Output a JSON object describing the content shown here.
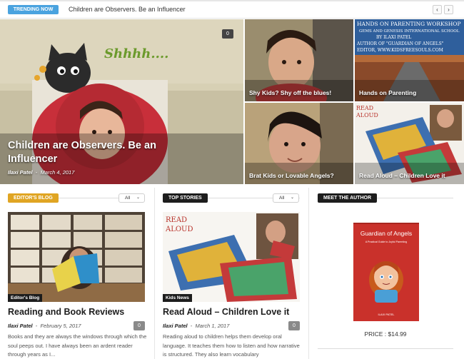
{
  "trending": {
    "badge": "TRENDING NOW",
    "headline": "Children are Observers. Be an Influencer",
    "prev_icon": "chevron-left-icon",
    "next_icon": "chevron-right-icon"
  },
  "featured": {
    "main": {
      "title": "Children are Observers. Be an Influencer",
      "author": "Ilaxi Patel",
      "date": "March 4, 2017",
      "comments": "0",
      "image_text": "Shhhh...."
    },
    "tiles": [
      {
        "title": "Shy Kids? Shy off the blues!"
      },
      {
        "title": "Hands on Parenting",
        "image_lines": [
          "HANDS ON PARENTING WORKSHOP",
          "GEMS AND GENESIS INTERNATIONAL SCHOOL",
          "BY ILAXI PATEL",
          "AUTHOR OF \"GUARDIAN OF ANGELS\"",
          "EDITOR, WWW.KIDSFREESOULS.COM"
        ]
      },
      {
        "title": "Brat Kids or Lovable Angels?"
      },
      {
        "title": "Read Aloud – Children Love it",
        "image_lines": [
          "READ",
          "ALOUD"
        ]
      }
    ]
  },
  "editors_blog": {
    "header": "EDITOR'S BLOG",
    "filter": "All",
    "category": "Editor's Blog",
    "title": "Reading and Book Reviews",
    "author": "Ilaxi Patel",
    "date": "February 5, 2017",
    "comments": "0",
    "excerpt": "Books and they are always the windows through which the soul peeps out. I have always been an ardent reader through years as I..."
  },
  "top_stories": {
    "header": "TOP STORIES",
    "filter": "All",
    "category": "Kids News",
    "title": "Read Aloud – Children Love it",
    "author": "Ilaxi Patel",
    "date": "March 1, 2017",
    "comments": "0",
    "excerpt": "Reading aloud to children helps them develop oral language. It teaches them how to listen and how narrative is structured. They also learn vocabulary",
    "image_lines": [
      "READ",
      "ALOUD"
    ]
  },
  "meet_author": {
    "header": "MEET THE AUTHOR",
    "book_title": "Guardian of Angels",
    "book_subtitle": "A Practical Guide to Joyful Parenting",
    "book_author": "ILAXI PATEL",
    "price": "PRICE : $14.99"
  },
  "colors": {
    "trending_badge": "#4aa3df",
    "editors_badge": "#e0a523",
    "dark_badge": "#1d1d1d",
    "book_cover": "#c9312b"
  }
}
